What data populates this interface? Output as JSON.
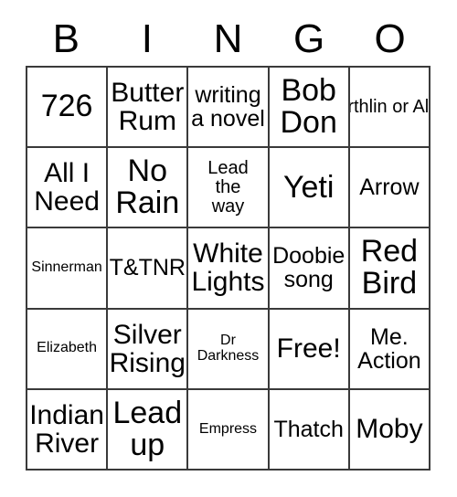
{
  "card": {
    "title": "BINGO",
    "header_letters": [
      "B",
      "I",
      "N",
      "G",
      "O"
    ],
    "columns": 5,
    "rows": 5,
    "border_color": "#3a3a3a",
    "background_color": "#ffffff",
    "text_color": "#000000",
    "free_space": "Free!",
    "free_space_position": {
      "row": 4,
      "column": 3
    },
    "cells": [
      [
        {
          "text": "726",
          "size": "xl"
        },
        {
          "text": "Butter\nRum",
          "size": "lg"
        },
        {
          "text": "writing\na novel",
          "size": "md"
        },
        {
          "text": "Bob\nDon",
          "size": "xl"
        },
        {
          "text": "Earthlin\nor\nAlien",
          "size": "sm"
        }
      ],
      [
        {
          "text": "All I\nNeed",
          "size": "lg"
        },
        {
          "text": "No\nRain",
          "size": "xl"
        },
        {
          "text": "Lead\nthe\nway",
          "size": "sm"
        },
        {
          "text": "Yeti",
          "size": "xl"
        },
        {
          "text": "Arrow",
          "size": "md"
        }
      ],
      [
        {
          "text": "Sinnerman",
          "size": "xs"
        },
        {
          "text": "T&TNR",
          "size": "md"
        },
        {
          "text": "White\nLights",
          "size": "lg"
        },
        {
          "text": "Doobie\nsong",
          "size": "md"
        },
        {
          "text": "Red\nBird",
          "size": "xl"
        }
      ],
      [
        {
          "text": "Elizabeth",
          "size": "xs"
        },
        {
          "text": "Silver\nRising",
          "size": "lg"
        },
        {
          "text": "Dr\nDarkness",
          "size": "xs"
        },
        {
          "text": "Free!",
          "size": "lg"
        },
        {
          "text": "Me.\nAction",
          "size": "md"
        }
      ],
      [
        {
          "text": "Indian\nRiver",
          "size": "lg"
        },
        {
          "text": "Lead\nup",
          "size": "xl"
        },
        {
          "text": "Empress",
          "size": "xs"
        },
        {
          "text": "Thatch",
          "size": "md"
        },
        {
          "text": "Moby",
          "size": "lg"
        }
      ]
    ]
  }
}
